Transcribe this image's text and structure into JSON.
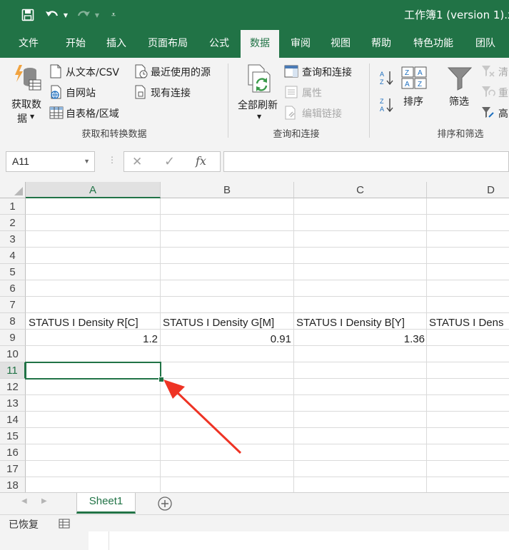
{
  "window": {
    "title": "工作簿1 (version 1).x"
  },
  "quick_access": [
    "save-icon",
    "undo-icon",
    "redo-icon",
    "customize-icon"
  ],
  "tabs": [
    {
      "label": "文件"
    },
    {
      "label": "开始"
    },
    {
      "label": "插入"
    },
    {
      "label": "页面布局"
    },
    {
      "label": "公式"
    },
    {
      "label": "数据",
      "active": true
    },
    {
      "label": "审阅"
    },
    {
      "label": "视图"
    },
    {
      "label": "帮助"
    },
    {
      "label": "特色功能"
    },
    {
      "label": "团队"
    }
  ],
  "ribbon": {
    "get_data_line1": "获取数",
    "get_data_line2": "据",
    "from_text_csv": "从文本/CSV",
    "from_web": "自网站",
    "from_table": "自表格/区域",
    "recent_sources": "最近使用的源",
    "existing_connections": "现有连接",
    "group_get_transform": "获取和转换数据",
    "refresh_all": "全部刷新",
    "queries_connections": "查询和连接",
    "properties": "属性",
    "edit_links": "编辑链接",
    "group_queries": "查询和连接",
    "sort": "排序",
    "filter": "筛选",
    "clear": "清",
    "reapply": "重",
    "advanced": "高",
    "group_sort_filter": "排序和筛选"
  },
  "formula_bar": {
    "name_box": "A11",
    "fx": "fx",
    "formula": ""
  },
  "grid": {
    "columns": [
      "A",
      "B",
      "C",
      "D"
    ],
    "rows": [
      "1",
      "2",
      "3",
      "4",
      "5",
      "6",
      "7",
      "8",
      "9",
      "10",
      "11",
      "12",
      "13",
      "14",
      "15",
      "16",
      "17",
      "18"
    ],
    "cells": {
      "A8": "STATUS I Density R[C]",
      "B8": "STATUS I Density G[M]",
      "C8": "STATUS I Density B[Y]",
      "D8": "STATUS I Dens",
      "A9": "1.2",
      "B9": "0.91",
      "C9": "1.36"
    },
    "active_cell": "A11"
  },
  "sheets": {
    "active": "Sheet1"
  },
  "status": {
    "text": "已恢复"
  },
  "colors": {
    "accent": "#217346",
    "annotation_arrow": "#ee3324"
  }
}
